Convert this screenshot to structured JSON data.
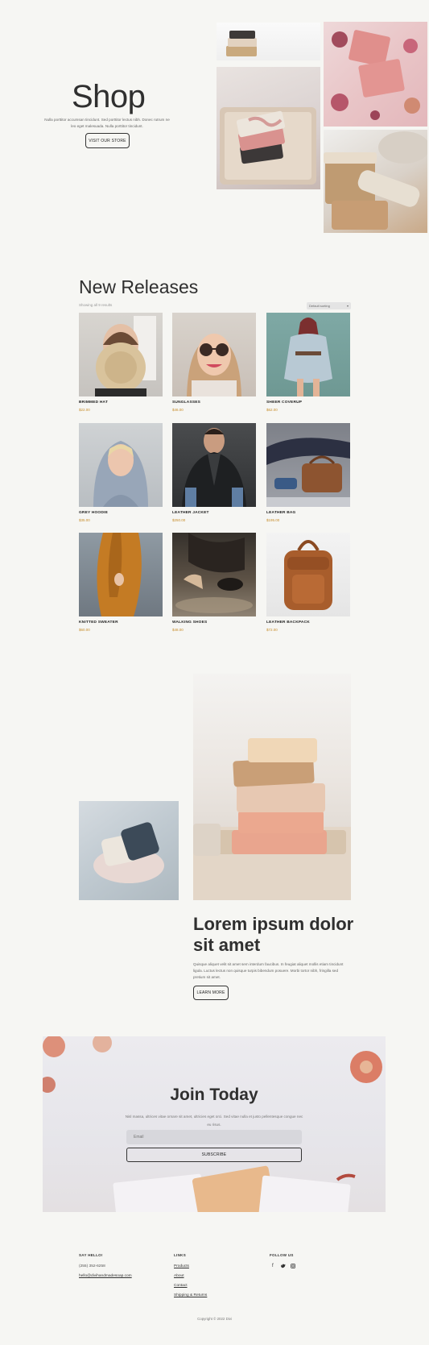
{
  "hero": {
    "title": "Shop",
    "text": "Nulla porttitor accumsan tincidunt. Sed porttitor lectus nibh. Donec rutrum ne leo eget malesuada. Nulla porttitor tincidunt.",
    "button_label": "VISIT OUR STORE"
  },
  "new_releases": {
    "title": "New Releases",
    "result_count": "Showing all 9 results",
    "sort_label": "Default sorting",
    "products": [
      {
        "name": "BRIMMED HAT",
        "price": "$22.00"
      },
      {
        "name": "SUNGLASSES",
        "price": "$46.00"
      },
      {
        "name": "SHEER COVERUP",
        "price": "$62.00"
      },
      {
        "name": "GREY HOODIE",
        "price": "$35.00"
      },
      {
        "name": "LEATHER JACKET",
        "price": "$250.00"
      },
      {
        "name": "LEATHER BAG",
        "price": "$195.00"
      },
      {
        "name": "KNITTED SWEATER",
        "price": "$60.00"
      },
      {
        "name": "WALKING SHOES",
        "price": "$48.00"
      },
      {
        "name": "LEATHER BACKPACK",
        "price": "$72.00"
      }
    ]
  },
  "feature": {
    "title": "Lorem ipsum dolor sit amet",
    "text": "Quisque aliquet velit sit amet sem interdum faucibus. In feugiat aliquet mollis etiam tincidunt ligula. Luctus lectus non quisque turpis bibendum posuere. Morbi tortor nibh, fringilla sed pretium sit amet.",
    "button_label": "LEARN MORE"
  },
  "join": {
    "title": "Join Today",
    "text": "Nisl massa, ultrices vitae ornare sit amet, ultricies eget orci. Sed vitae nulla et justo pellentesque congue nec eu risus.",
    "email_placeholder": "Email",
    "subscribe_label": "SUBSCRIBE"
  },
  "footer": {
    "say_hello": "SAY HELLO!",
    "phone": "(255) 352-6258",
    "email": "hello@divihandmadesoap.com",
    "links_heading": "LINKS",
    "links": [
      "Products",
      "About",
      "Contact",
      "Shipping & Returns"
    ],
    "follow_heading": "FOLLOW US",
    "social_icons": [
      "facebook-icon",
      "twitter-icon",
      "instagram-icon"
    ],
    "copyright": "Copyright © 2022 Divi"
  },
  "colors": {
    "background": "#f6f6f3",
    "price": "#c78d2b",
    "text": "#2f2f2f"
  }
}
